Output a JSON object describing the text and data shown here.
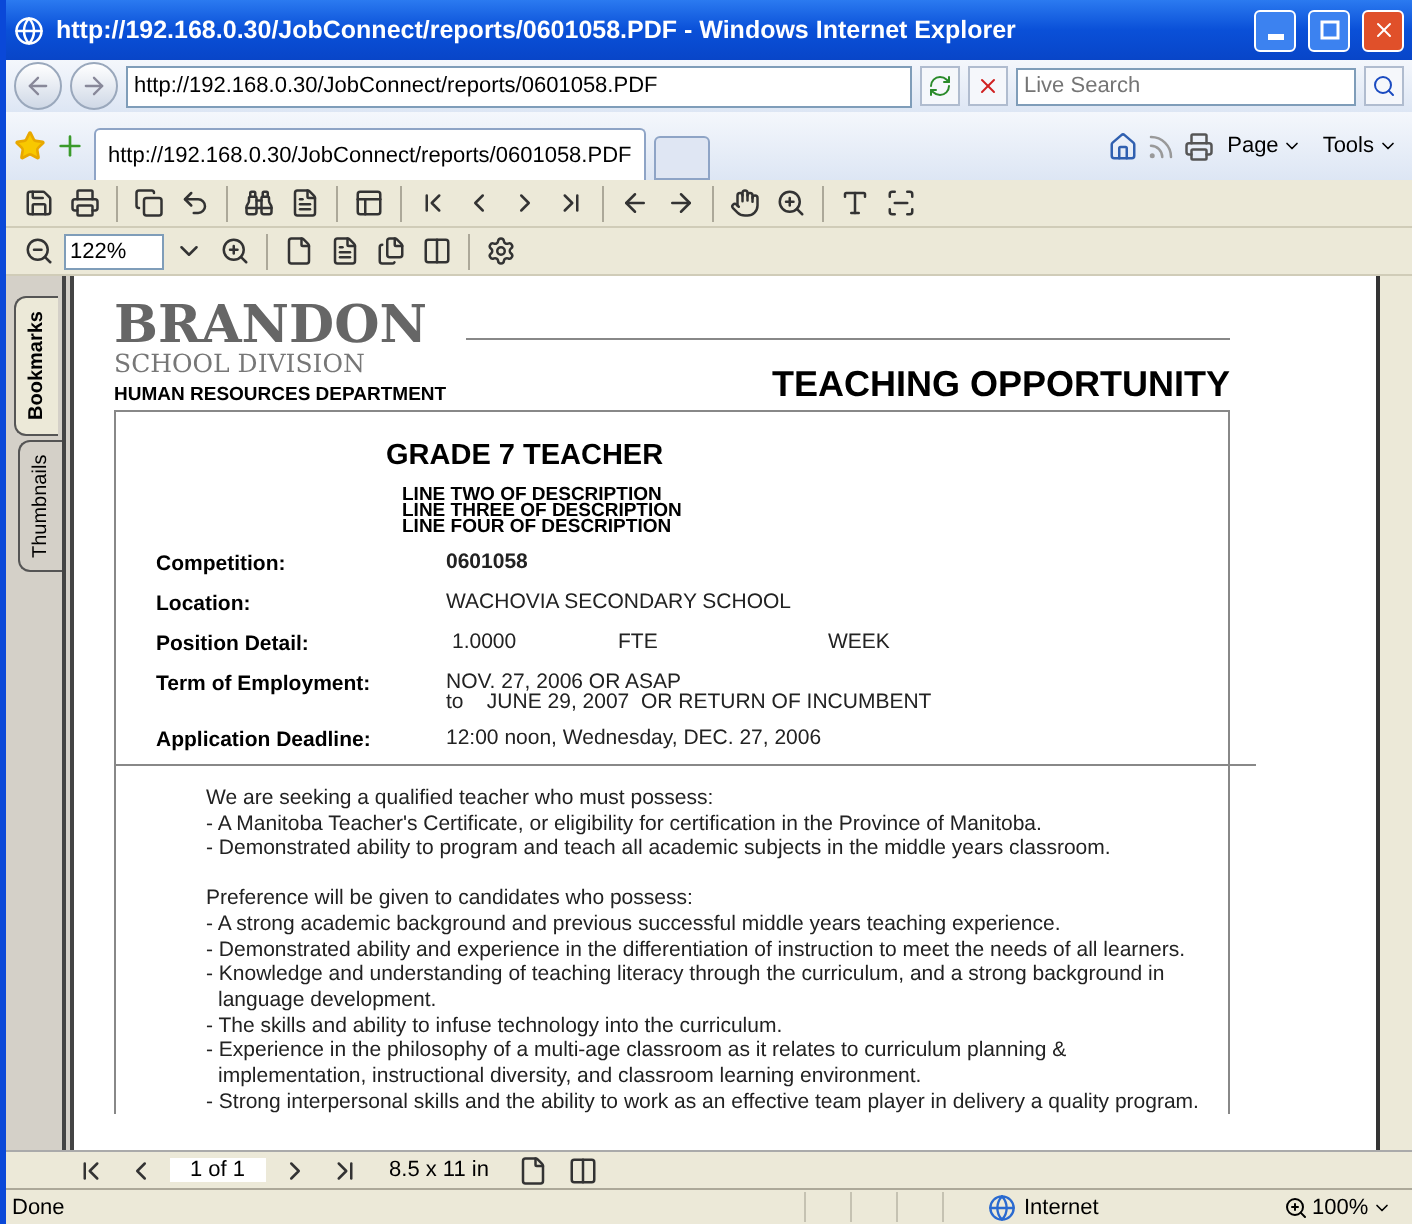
{
  "window": {
    "title": "http://192.168.0.30/JobConnect/reports/0601058.PDF - Windows Internet Explorer"
  },
  "address_bar": {
    "url": "http://192.168.0.30/JobConnect/reports/0601058.PDF"
  },
  "search": {
    "placeholder": "Live Search"
  },
  "tabs": [
    {
      "title": "http://192.168.0.30/JobConnect/reports/0601058.PDF",
      "selected": true
    }
  ],
  "command_bar": [
    "Page",
    "Tools"
  ],
  "viewer": {
    "zoom": "122%"
  },
  "nav_tabs": [
    {
      "label": "Bookmarks",
      "selected": true
    },
    {
      "label": "Thumbnails",
      "selected": false
    }
  ],
  "document": {
    "logo_name": "BRANDON",
    "logo_sub": "SCHOOL DIVISION",
    "department": "HUMAN RESOURCES DEPARTMENT",
    "heading": "TEACHING OPPORTUNITY",
    "title": "GRADE 7 TEACHER",
    "description_lines": [
      "LINE TWO OF DESCRIPTION",
      "LINE THREE OF DESCRIPTION",
      "LINE FOUR OF DESCRIPTION"
    ],
    "fields": [
      {
        "label": "Competition:",
        "values": [
          "0601058"
        ],
        "bold": true
      },
      {
        "label": "Location:",
        "values": [
          "WACHOVIA SECONDARY SCHOOL"
        ],
        "bold": false
      },
      {
        "label": "Position Detail:",
        "values": [
          "1.0000",
          "FTE",
          "WEEK"
        ],
        "bold": false
      },
      {
        "label": "Term of Employment:",
        "values": [
          "NOV. 27, 2006 OR ASAP",
          "to    JUNE 29, 2007  OR RETURN OF INCUMBENT"
        ],
        "bold": false
      },
      {
        "label": "Application Deadline:",
        "values": [
          "12:00 noon, Wednesday, DEC. 27, 2006"
        ],
        "bold": false
      }
    ],
    "paragraphs": [
      {
        "intro": "We are seeking a qualified teacher who must possess:",
        "items": [
          "- A Manitoba Teacher's Certificate, or eligibility for certification in the Province of Manitoba.",
          "- Demonstrated ability to program and teach all academic subjects in the middle years classroom."
        ]
      },
      {
        "intro": "Preference will be given to candidates who possess:",
        "items": [
          "- A strong academic background and previous successful middle years teaching experience.",
          "- Demonstrated ability and experience in the differentiation of instruction to meet the needs of all learners.",
          "- Knowledge and understanding of teaching literacy through the curriculum, and a strong background in language development.",
          "- The skills and ability to infuse technology into the curriculum.",
          "- Experience in the philosophy of a multi-age classroom as it relates to curriculum planning & implementation, instructional diversity, and classroom learning environment.",
          "- Strong interpersonal skills and the ability to work as an effective team player in delivery a quality program."
        ]
      }
    ]
  },
  "page_nav": {
    "page": "1 of 1",
    "size": "8.5 x 11 in"
  },
  "status_bar": {
    "text": "Done",
    "zone": "Internet",
    "zoom": "100%"
  }
}
